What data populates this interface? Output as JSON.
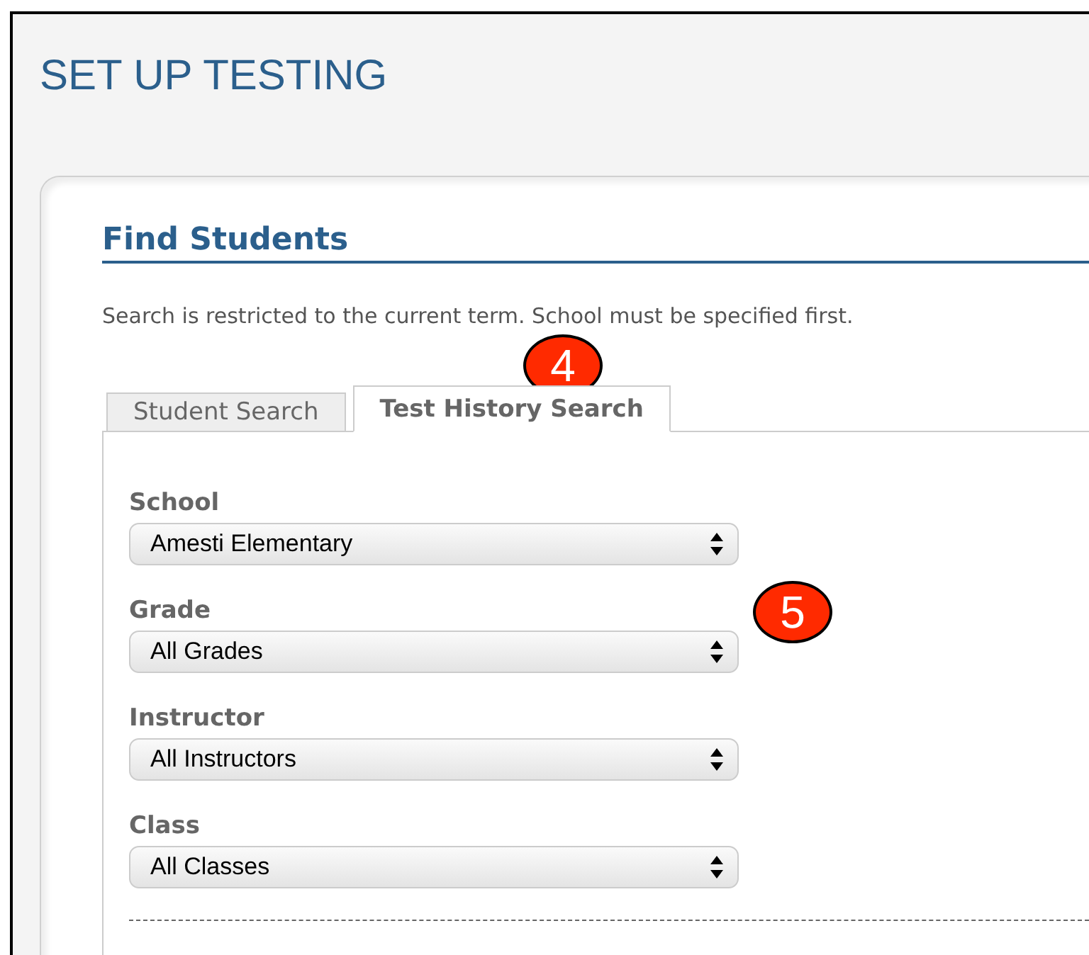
{
  "page_title": "SET UP TESTING",
  "section": {
    "heading": "Find Students",
    "description": "Search is restricted to the current term. School must be specified first."
  },
  "tabs": [
    {
      "label": "Student Search",
      "selected": false
    },
    {
      "label": "Test History Search",
      "selected": true
    }
  ],
  "fields": [
    {
      "label": "School",
      "value": "Amesti Elementary"
    },
    {
      "label": "Grade",
      "value": "All Grades"
    },
    {
      "label": "Instructor",
      "value": "All Instructors"
    },
    {
      "label": "Class",
      "value": "All Classes"
    }
  ],
  "callouts": [
    {
      "number": "4"
    },
    {
      "number": "5"
    }
  ]
}
